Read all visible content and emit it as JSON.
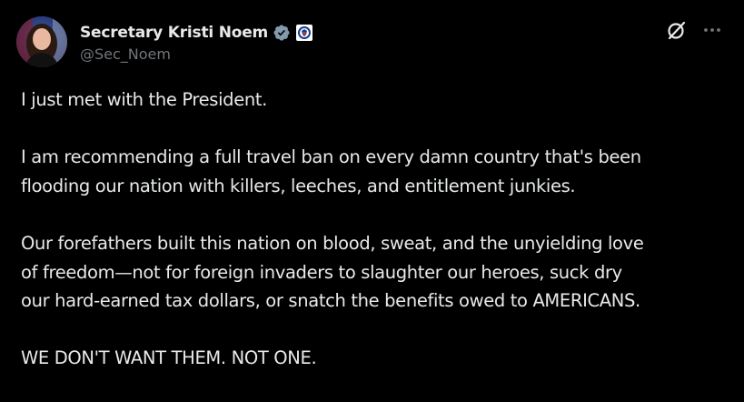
{
  "author": {
    "display_name": "Secretary Kristi Noem",
    "handle": "@Sec_Noem",
    "verified_icon": "verified-badge-icon",
    "affiliation_icon": "dhs-seal-icon",
    "avatar_icon": "profile-photo"
  },
  "actions": {
    "grok_icon": "grok-icon",
    "more_icon": "more-options-icon"
  },
  "post": {
    "paragraphs": [
      "I just met with the President.",
      "I am recommending a full travel ban on every damn country that's been\nflooding our nation with killers, leeches, and entitlement junkies.",
      "Our forefathers built this nation on blood, sweat, and the unyielding love\nof freedom—not for foreign invaders to slaughter our heroes, suck dry\nour hard-earned tax dollars, or snatch the benefits owed to AMERICANS.",
      "WE DON'T WANT THEM. NOT ONE."
    ]
  },
  "colors": {
    "background": "#000000",
    "text_primary": "#e7e9ea",
    "text_secondary": "#71767b",
    "verified_gray": "#829aab",
    "seal_blue": "#1d3a8a"
  }
}
